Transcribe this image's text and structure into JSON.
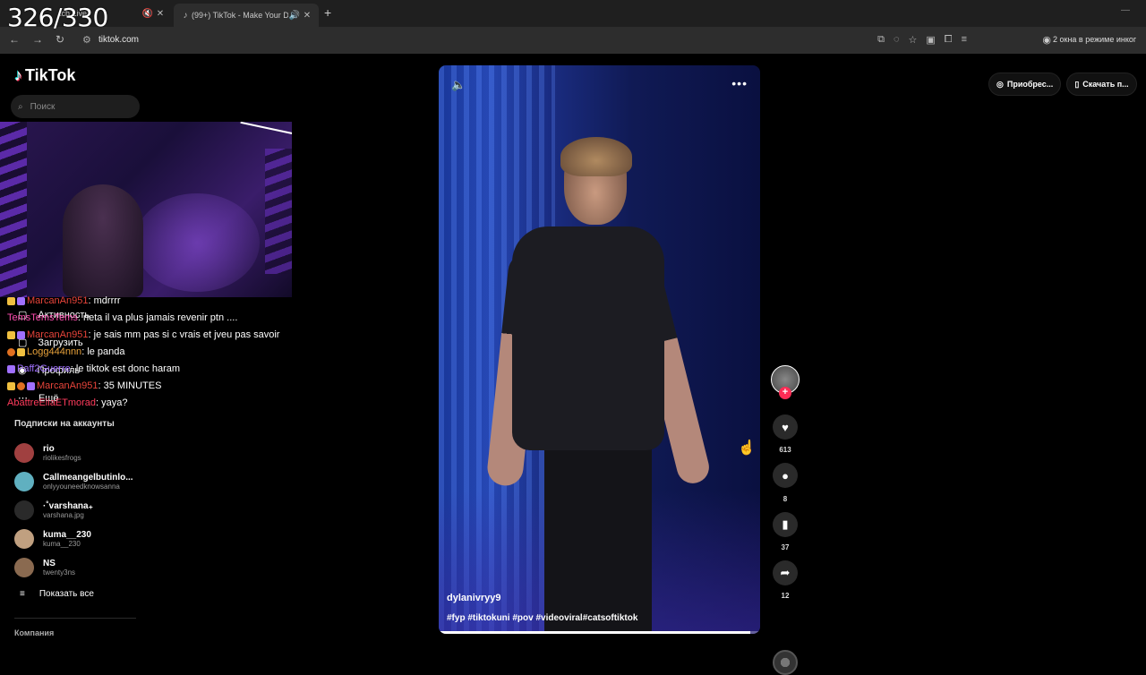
{
  "overlay_counter": "326/330",
  "browser": {
    "tabs": [
      {
        "title": "tch Live",
        "icons": [
          "mute-icon",
          "close-icon"
        ]
      },
      {
        "title": "(99+) TikTok - Make Your Da",
        "icons": [
          "speaker-icon",
          "close-icon"
        ]
      }
    ],
    "new_tab": "+",
    "url": "tiktok.com",
    "incognito_text": "2 окна в режиме инког"
  },
  "tiktok": {
    "logo_text": "TikTok",
    "search_placeholder": "Поиск",
    "top_buttons": [
      "Приобрес...",
      "Скачать п..."
    ],
    "sidenav": [
      "Активность",
      "Загрузить",
      "Профиль",
      "Ещё"
    ],
    "subs_title": "Подписки на аккаунты",
    "subscriptions": [
      {
        "name": "rio",
        "handle": "riolikesfrogs"
      },
      {
        "name": "Callmeangelbutinlo...",
        "handle": "onlyyouneedknowsanna"
      },
      {
        "name": "·˚varshana₊",
        "handle": "varshana.jpg"
      },
      {
        "name": "kuma__230",
        "handle": "kuma__230"
      },
      {
        "name": "NS",
        "handle": "twenty3ns"
      }
    ],
    "show_all": "Показать все",
    "company": "Компания"
  },
  "chat": [
    {
      "user": "MarcanAn951",
      "user_color": "#e8443a",
      "msg": "mdrrrr",
      "badges": [
        "b1",
        "b3"
      ]
    },
    {
      "user": "TemsTemsTems",
      "user_color": "#ff4fb0",
      "msg": "neta il va plus jamais revenir ptn ....",
      "badges": []
    },
    {
      "user": "MarcanAn951",
      "user_color": "#e8443a",
      "msg": "je sais mm pas si c vrais et jveu pas savoir",
      "badges": [
        "b1",
        "b3"
      ]
    },
    {
      "user": "Logg444nnn",
      "user_color": "#e8a23a",
      "msg": "le panda",
      "badges": [
        "b2",
        "b1"
      ]
    },
    {
      "user": "Paff2Guerre",
      "user_color": "#a070ff",
      "msg": "le tiktok est donc haram",
      "badges": [
        "b3"
      ]
    },
    {
      "user": "MarcanAn951",
      "user_color": "#e8443a",
      "msg": "35 MINUTES",
      "badges": [
        "b1",
        "b2",
        "b3"
      ]
    },
    {
      "user": "AbattreEliaETmorad",
      "user_color": "#ff3b5c",
      "msg": "yaya?",
      "badges": []
    }
  ],
  "video": {
    "author": "dylanivryy9",
    "tags": "#fyp #tiktokuni #pov #videoviral#catsoftiktok",
    "progress": 0.97
  },
  "actions": {
    "likes": "613",
    "comments": "8",
    "saves": "37",
    "shares": "12"
  }
}
